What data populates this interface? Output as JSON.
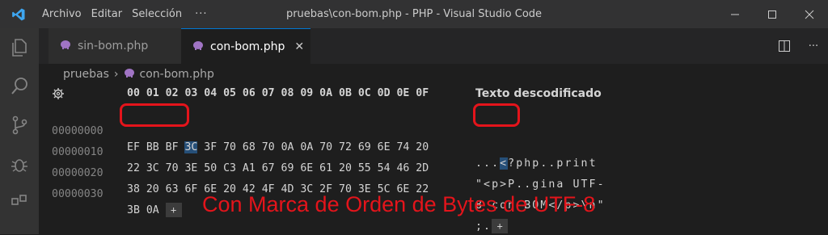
{
  "window": {
    "title": "pruebas\\con-bom.php - PHP - Visual Studio Code",
    "menu": [
      "Archivo",
      "Editar",
      "Selección"
    ],
    "more": "···"
  },
  "tabs": [
    {
      "label": "sin-bom.php",
      "icon": "php-elephant-icon",
      "active": false
    },
    {
      "label": "con-bom.php",
      "icon": "php-elephant-icon",
      "active": true,
      "close": "✕"
    }
  ],
  "breadcrumb": [
    "pruebas",
    "con-bom.php"
  ],
  "hex": {
    "header": "00 01 02 03 04 05 06 07 08 09 0A 0B 0C 0D 0E 0F",
    "text_header": "Texto descodificado",
    "rows": [
      {
        "addr": "00000000",
        "bytes_bom": "EF BB BF ",
        "bytes_sel": "3C",
        "bytes_rest": " 3F 70 68 70 0A 0A 70 72 69 6E 74 20",
        "text_bom": "...",
        "text_sel": "<",
        "text_rest": "?php..print "
      },
      {
        "addr": "00000010",
        "bytes": "22 3C 70 3E 50 C3 A1 67 69 6E 61 20 55 54 46 2D",
        "text": "\"<p>P..gina UTF-"
      },
      {
        "addr": "00000020",
        "bytes": "38 20 63 6F 6E 20 42 4F 4D 3C 2F 70 3E 5C 6E 22",
        "text": "8 con BOM</p>\\n\""
      },
      {
        "addr": "00000030",
        "bytes": "3B 0A ",
        "text": ";.",
        "plus": "+"
      }
    ]
  },
  "annotation": "Con Marca de Orden de Bytes de UTF-8",
  "colors": {
    "highlight": "#e4141b",
    "selection": "#264f78",
    "accent": "#0078d4"
  }
}
